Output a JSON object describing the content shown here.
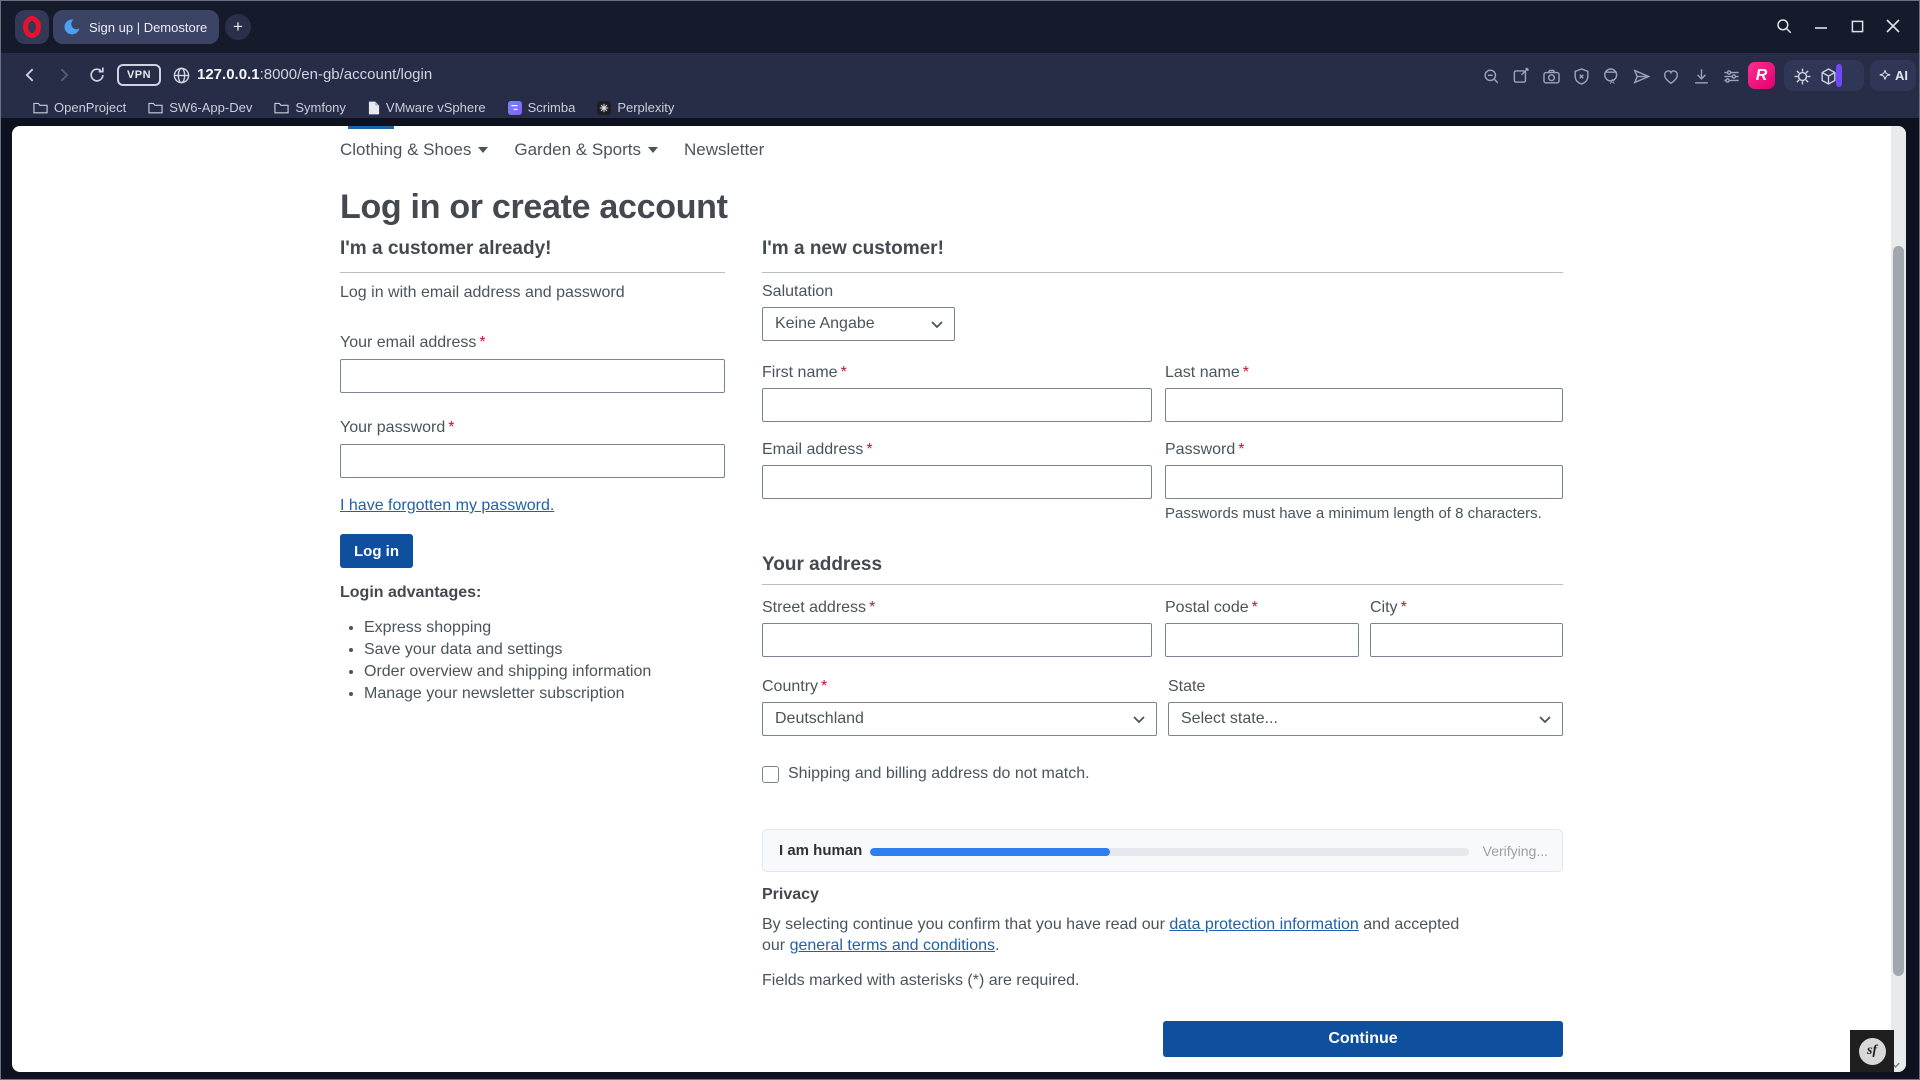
{
  "colors": {
    "accent_blue": "#0e4f9e",
    "link_blue": "#2061a8",
    "progress_blue": "#2e7ef0",
    "opera_red": "#e8112d",
    "extension_pink": "#e1006d",
    "profile_purple": "#7048f7",
    "asterisk_red": "#c4122f"
  },
  "browser": {
    "tab_title": "Sign up | Demostore",
    "new_tab": "+",
    "url_host": "127.0.0.1",
    "url_rest": ":8000/en-gb/account/login",
    "vpn_label": "VPN",
    "ai_label": "AI",
    "r_extension_label": "R",
    "bookmarks": [
      {
        "label": "OpenProject",
        "icon": "folder"
      },
      {
        "label": "SW6-App-Dev",
        "icon": "folder"
      },
      {
        "label": "Symfony",
        "icon": "folder"
      },
      {
        "label": "VMware vSphere",
        "icon": "file"
      },
      {
        "label": "Scrimba",
        "icon": "scrimba-logo"
      },
      {
        "label": "Perplexity",
        "icon": "perplexity-logo"
      }
    ]
  },
  "nav": {
    "items": [
      {
        "label": "Clothing & Shoes"
      },
      {
        "label": "Garden & Sports"
      },
      {
        "label": "Newsletter"
      }
    ]
  },
  "page": {
    "title": "Log in or create account",
    "required_mark": "*",
    "login": {
      "heading": "I'm a customer already!",
      "intro": "Log in with email address and password",
      "email_label": "Your email address",
      "password_label": "Your password",
      "forgot_password_link": "I have forgotten my password.",
      "submit_label": "Log in",
      "advantages_heading": "Login advantages:",
      "advantages": [
        "Express shopping",
        "Save your data and settings",
        "Order overview and shipping information",
        "Manage your newsletter subscription"
      ]
    },
    "register": {
      "heading": "I'm a new customer!",
      "salutation_label": "Salutation",
      "salutation_value": "Keine Angabe",
      "first_name_label": "First name",
      "last_name_label": "Last name",
      "email_label": "Email address",
      "password_label": "Password",
      "password_hint": "Passwords must have a minimum length of 8 characters.",
      "address_heading": "Your address",
      "street_label": "Street address",
      "postal_label": "Postal code",
      "city_label": "City",
      "country_label": "Country",
      "country_value": "Deutschland",
      "state_label": "State",
      "state_value": "Select state...",
      "billing_checkbox_label": "Shipping and billing address do not match.",
      "captcha": {
        "label": "I am human",
        "status": "Verifying...",
        "progress_percent": 40
      },
      "privacy_heading": "Privacy",
      "privacy_text_before": "By selecting continue you confirm that you have read our ",
      "privacy_link_data": "data protection information",
      "privacy_text_middle": " and accepted our ",
      "privacy_link_terms": "general terms and conditions",
      "privacy_text_after": ".",
      "required_note": "Fields marked with asterisks (*) are required.",
      "continue_label": "Continue"
    },
    "symfony_badge": "sf"
  }
}
